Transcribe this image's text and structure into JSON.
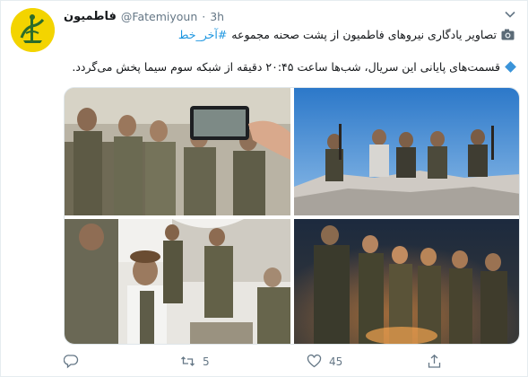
{
  "tweet": {
    "author_name": "فاطمیون",
    "handle": "@Fatemiyoun",
    "separator": "·",
    "time": "3h",
    "line1_text": "تصاویر یادگاری نیروهای فاطمیون از پشت صحنه مجموعه",
    "line1_hashtag": "#آخر_خط",
    "line2_text": "قسمت‌های پایانی این سریال، شب‌ها ساعت ۲۰:۴۵ دقیقه از شبکه سوم سیما پخش می‌گردد.",
    "hashtag_color": "#1b95e0"
  },
  "icons": {
    "avatar": "fatemiyoun-emblem",
    "menu": "chevron-down-icon",
    "line1": "camera-icon",
    "line2": "small-blue-diamond-icon",
    "reply": "reply-icon",
    "retweet": "retweet-icon",
    "like": "heart-icon",
    "share": "share-icon"
  },
  "photos": [
    {
      "description_name": "group-selfie-photo"
    },
    {
      "description_name": "mountain-group-photo"
    },
    {
      "description_name": "village-lunch-photo"
    },
    {
      "description_name": "night-fire-group-photo"
    }
  ],
  "actions": {
    "reply_count": "",
    "retweet_count": "5",
    "like_count": "45"
  }
}
